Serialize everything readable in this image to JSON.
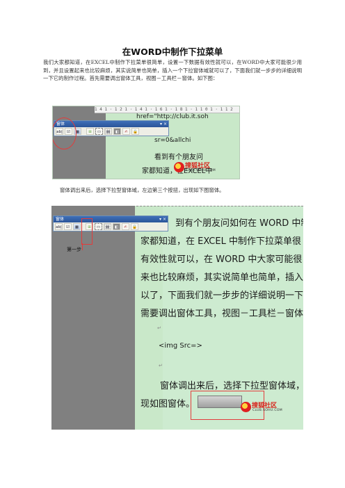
{
  "title": "在WORD中制作下拉菜单",
  "paragraph": "我们大家都知道，在EXCEL中制作下拉菜单很简单，设置一下数据有效性就可以，在WORD中大家可能很少用到，并且设置起来也比较麻烦，其实说简单也简单，插入一个下拉窗体域就可以了，下面我们就一步步的详细说明一下它的制作过程。首先需要调出窗体工具，视图－工具栏－窗体。如下图：",
  "caption": "窗体调出来后，选择下拉型窗体域，左边第三个按扭，出现如下图窗体。",
  "toolbar": {
    "title": "窗体",
    "close": "▾ ×",
    "buttons": [
      "ab|",
      "☑",
      "▦",
      "⊞",
      "▭",
      "▤",
      "◧",
      "✍",
      "🔒"
    ]
  },
  "shot1": {
    "ruler": "1 4 1 · 1 2 1 · 1 4 1 · 1 6 1 · 1 8 1 · 1 1 0 1 · 1 1 2",
    "line1": "href=\"http://club.it.soh",
    "line2": "sr=0&allchi",
    "line3": "看到有个朋友问",
    "line4": "家都知道，在EXCEL中"
  },
  "shot2": {
    "step": "第一步",
    "lines": [
      "到有个朋友问如何在 WORD 中制",
      "家都知道，在 EXCEL 中制作下拉菜单很",
      "有效性就可以，在 WORD 中大家可能很",
      "来也比较麻烦，其实说简单也简单，插入",
      "以了，下面我们就一步步的详细说明一下",
      "需要调出窗体工具，视图－工具栏－窗体"
    ],
    "img_tag": "<img Src=>",
    "line_after1": "窗体调出来后，选择下拉型窗体域，",
    "line_after2": "现如图窗体。"
  },
  "watermark": {
    "cn": "搜狐社区",
    "en": "CLUB.SOHU.COM"
  }
}
